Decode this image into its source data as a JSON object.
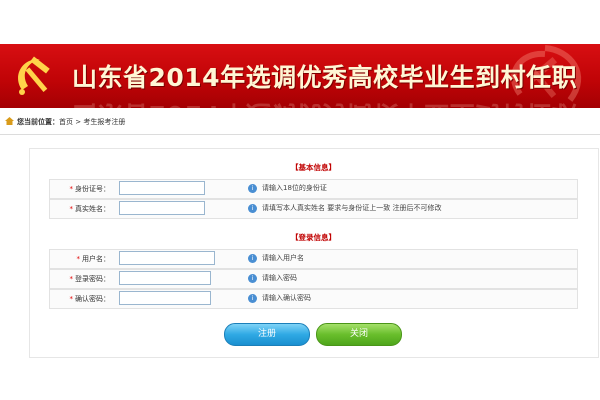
{
  "header": {
    "title": "山东省2014年选调优秀高校毕业生到村任职"
  },
  "breadcrumb": {
    "label": "您当前位置：",
    "home": "首页",
    "separator": ">",
    "current": "考生报考注册"
  },
  "basic_section": {
    "title": "【基本信息】",
    "fields": [
      {
        "label": "身份证号：",
        "required": "*",
        "value": "",
        "hint": "请输入18位的身份证"
      },
      {
        "label": "真实姓名：",
        "required": "*",
        "value": "",
        "hint": "请填写本人真实姓名 要求与身份证上一致 注册后不可修改"
      }
    ]
  },
  "login_section": {
    "title": "【登录信息】",
    "fields": [
      {
        "label": "用户名：",
        "required": "*",
        "value": "",
        "hint": "请输入用户名"
      },
      {
        "label": "登录密码：",
        "required": "*",
        "value": "",
        "hint": "请输入密码"
      },
      {
        "label": "确认密码：",
        "required": "*",
        "value": "",
        "hint": "请输入确认密码"
      }
    ]
  },
  "buttons": {
    "register": "注册",
    "close": "关闭"
  },
  "colors": {
    "banner_red": "#c10407",
    "required_star": "#e00000",
    "register_blue": "#2fa9e4",
    "close_green": "#69be2c"
  },
  "icons": {
    "emblem": "hammer-sickle-icon",
    "home": "home-icon",
    "info": "info-icon"
  }
}
